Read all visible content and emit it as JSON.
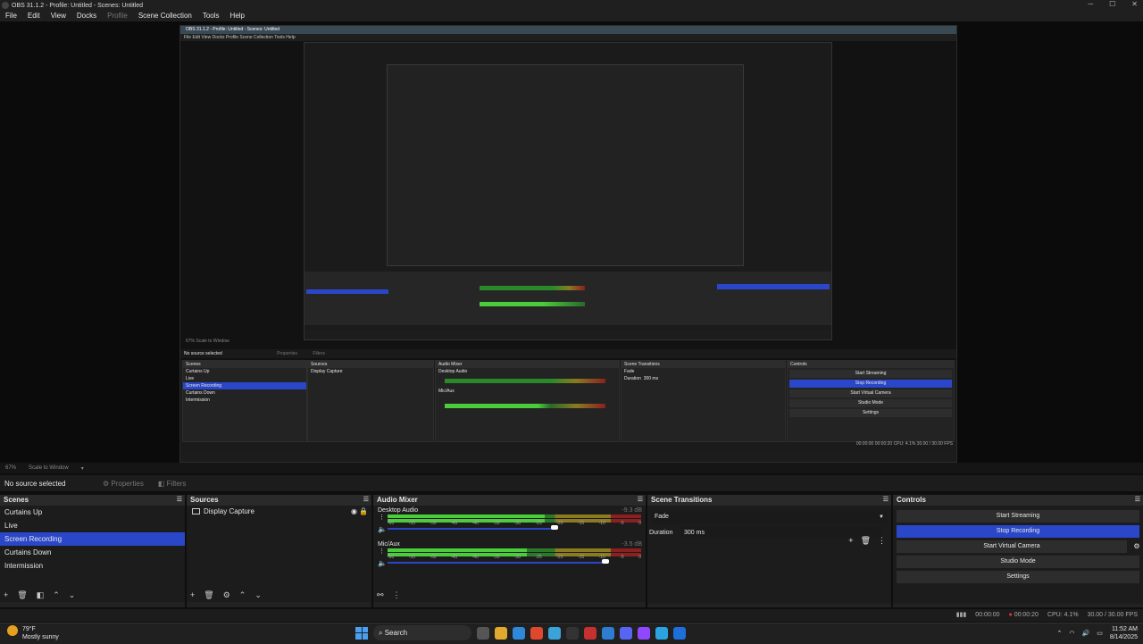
{
  "window": {
    "title": "OBS 31.1.2 - Profile: Untitled - Scenes: Untitled"
  },
  "menu": [
    "File",
    "Edit",
    "View",
    "Docks",
    "Profile",
    "Scene Collection",
    "Tools",
    "Help"
  ],
  "nested": {
    "title": "OBS 31.1.2 - Profile: Untitled - Scenes: Untitled",
    "menu": "File  Edit  View  Docks  Profile  Scene Collection  Tools  Help",
    "zoom": "67%   Scale to Window",
    "no_source": "No source selected",
    "properties": "Properties",
    "filters": "Filters",
    "scenes_title": "Scenes",
    "scenes": [
      "Curtains Up",
      "Live",
      "Screen Recording",
      "Curtains Down",
      "Intermission"
    ],
    "sources_title": "Sources",
    "source": "Display Capture",
    "mixer_title": "Audio Mixer",
    "ch1": "Desktop Audio",
    "ch2": "Mic/Aux",
    "transitions_title": "Scene Transitions",
    "fade": "Fade",
    "duration": "Duration",
    "duration_val": "300 ms",
    "controls_title": "Controls",
    "controls": [
      "Start Streaming",
      "Stop Recording",
      "Start Virtual Camera",
      "Studio Mode",
      "Settings"
    ],
    "status": "00:00:00   00:00:20   CPU: 4.1%   30.00 / 30.00 FPS"
  },
  "zoombar": {
    "zoom": "67%",
    "scale": "Scale to Window"
  },
  "source_toolbar": {
    "no_source": "No source selected",
    "properties": "Properties",
    "filters": "Filters"
  },
  "scenes": {
    "title": "Scenes",
    "items": [
      "Curtains Up",
      "Live",
      "Screen Recording",
      "Curtains Down",
      "Intermission"
    ],
    "selected": 2
  },
  "sources": {
    "title": "Sources",
    "items": [
      "Display Capture"
    ]
  },
  "mixer": {
    "title": "Audio Mixer",
    "scale": [
      "-60",
      "-55",
      "-50",
      "-45",
      "-40",
      "-35",
      "-30",
      "-25",
      "-20",
      "-15",
      "-10",
      "-5",
      "0"
    ],
    "channels": [
      {
        "name": "Desktop Audio",
        "db": "-9.3 dB",
        "volume": 0.66,
        "level": 0.62
      },
      {
        "name": "Mic/Aux",
        "db": "-3.5 dB",
        "volume": 0.86,
        "level": 0.55
      }
    ]
  },
  "transitions": {
    "title": "Scene Transitions",
    "selected": "Fade",
    "duration_label": "Duration",
    "duration": "300 ms"
  },
  "controls": {
    "title": "Controls",
    "buttons": [
      "Start Streaming",
      "Stop Recording",
      "Start Virtual Camera",
      "Studio Mode",
      "Settings"
    ],
    "active": 1
  },
  "status": {
    "stream_time": "00:00:00",
    "rec_time": "00:00:20",
    "cpu": "CPU: 4.1%",
    "fps": "30.00 / 30.00 FPS"
  },
  "taskbar": {
    "weather_temp": "79°F",
    "weather_desc": "Mostly sunny",
    "search": "Search",
    "time": "11:52 AM",
    "date": "8/14/2025"
  },
  "colors": {
    "accent": "#2b47c9",
    "green": "#4bcc3b",
    "rec": "#e33333"
  }
}
